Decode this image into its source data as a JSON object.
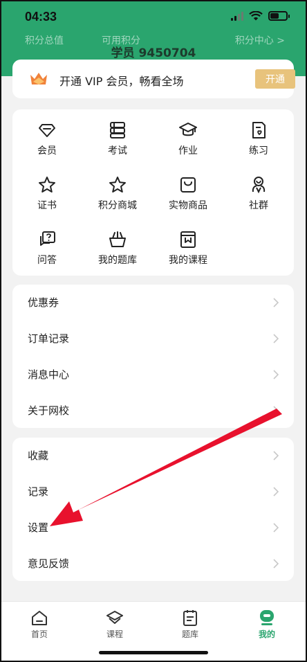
{
  "status": {
    "time": "04:33"
  },
  "points": {
    "total_label": "积分总值",
    "available_label": "可用积分",
    "center_link": "积分中心 >"
  },
  "user": {
    "name": "学员 9450704"
  },
  "vip": {
    "text": "开通 VIP 会员，畅看全场",
    "button": "开通",
    "accent": "#e8c37c"
  },
  "grid": {
    "items": [
      {
        "label": "会员",
        "icon": "diamond-icon"
      },
      {
        "label": "考试",
        "icon": "exam-icon"
      },
      {
        "label": "作业",
        "icon": "graduation-cap-icon"
      },
      {
        "label": "练习",
        "icon": "practice-icon"
      },
      {
        "label": "证书",
        "icon": "star-icon"
      },
      {
        "label": "积分商城",
        "icon": "star-icon"
      },
      {
        "label": "实物商品",
        "icon": "shopping-bag-icon"
      },
      {
        "label": "社群",
        "icon": "community-icon"
      },
      {
        "label": "问答",
        "icon": "question-chat-icon"
      },
      {
        "label": "我的题库",
        "icon": "basket-icon"
      },
      {
        "label": "我的课程",
        "icon": "book-icon"
      }
    ]
  },
  "list1": {
    "items": [
      "优惠券",
      "订单记录",
      "消息中心",
      "关于网校"
    ]
  },
  "list2": {
    "items": [
      "收藏",
      "记录",
      "设置",
      "意见反馈"
    ]
  },
  "tabs": {
    "items": [
      {
        "label": "首页",
        "icon": "home-icon"
      },
      {
        "label": "课程",
        "icon": "course-icon"
      },
      {
        "label": "题库",
        "icon": "question-bank-icon"
      },
      {
        "label": "我的",
        "icon": "profile-icon"
      }
    ],
    "active": "我的"
  },
  "colors": {
    "brand": "#2aa56e",
    "annotation_arrow": "#e8112d"
  }
}
